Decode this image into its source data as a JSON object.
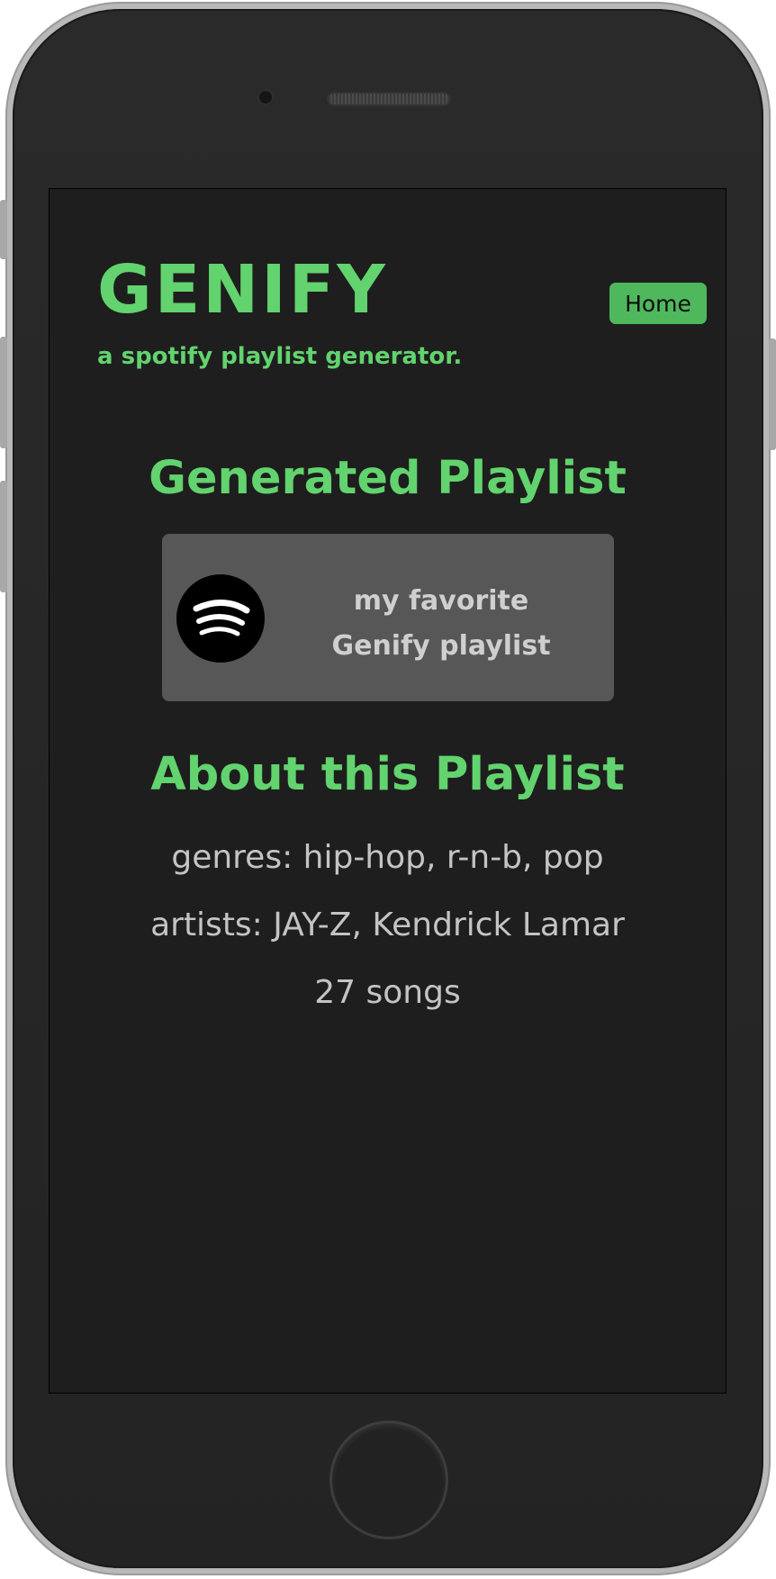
{
  "header": {
    "title": "GENIFY",
    "subtitle": "a spotify playlist generator.",
    "home_label": "Home"
  },
  "playlist": {
    "heading": "Generated Playlist",
    "card_title": "my favorite Genify playlist",
    "logo_icon": "spotify-icon"
  },
  "about": {
    "heading": "About this Playlist",
    "genres": "genres: hip-hop, r-n-b, pop",
    "artists": "artists: JAY-Z, Kendrick Lamar",
    "songs": "27 songs"
  },
  "colors": {
    "accent": "#62d36e",
    "button": "#4fb85d",
    "background": "#1e1e1e",
    "card": "#575757",
    "text": "#c4c4c4"
  }
}
